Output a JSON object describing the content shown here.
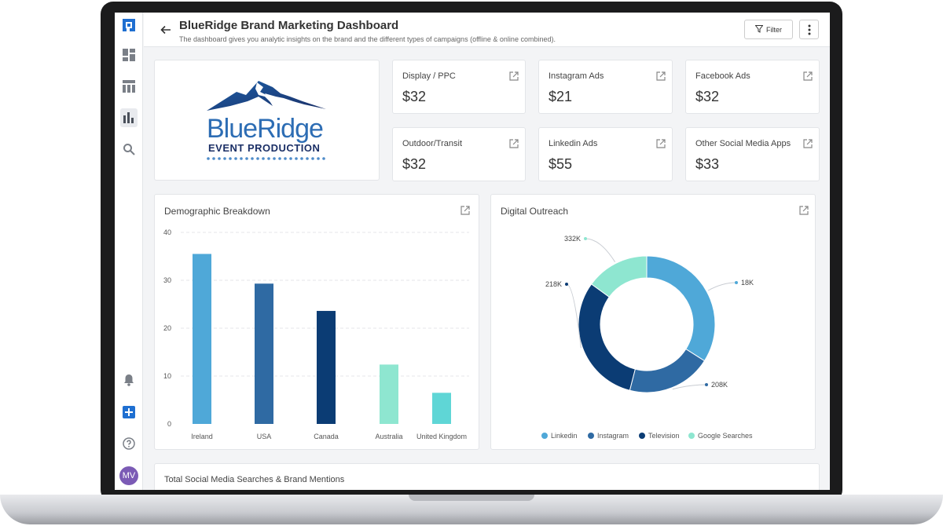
{
  "header": {
    "title": "BlueRidge Brand Marketing Dashboard",
    "subtitle": "The dashboard gives you analytic insights on the brand and the different types of campaigns (offline & online combined).",
    "filter_label": "Filter"
  },
  "logo": {
    "line1": "BlueRidge",
    "line2": "EVENT PRODUCTION"
  },
  "metrics": [
    {
      "label": "Display / PPC",
      "value": "$32"
    },
    {
      "label": "Instagram Ads",
      "value": "$21"
    },
    {
      "label": "Facebook Ads",
      "value": "$32"
    },
    {
      "label": "Outdoor/Transit",
      "value": "$32"
    },
    {
      "label": "Linkedin Ads",
      "value": "$55"
    },
    {
      "label": "Other Social Media Apps",
      "value": "$33"
    }
  ],
  "demographic": {
    "title": "Demographic Breakdown"
  },
  "outreach": {
    "title": "Digital Outreach"
  },
  "social": {
    "title": "Total Social Media Searches & Brand Mentions"
  },
  "user": {
    "initials": "MV"
  },
  "colors": {
    "accent": "#1f6fd1",
    "light_blue": "#4fa8d8",
    "mid_blue": "#2f6aa3",
    "navy": "#0b3c74",
    "mint": "#8ee6d0",
    "teal": "#5fd6d6"
  },
  "chart_data": [
    {
      "type": "bar",
      "title": "Demographic Breakdown",
      "categories": [
        "Ireland",
        "USA",
        "Canada",
        "Australia",
        "United Kingdom"
      ],
      "values": [
        35.5,
        29.3,
        23.6,
        12.4,
        6.5
      ],
      "colors": [
        "#4fa8d8",
        "#2f6aa3",
        "#0b3c74",
        "#8ee6d0",
        "#5fd6d6"
      ],
      "ylim": [
        0,
        40
      ],
      "yticks": [
        0,
        10,
        20,
        30,
        40
      ],
      "grid": true
    },
    {
      "type": "pie",
      "title": "Digital Outreach",
      "donut": true,
      "slices": [
        {
          "name": "Linkedin",
          "value": 34,
          "label": "18K",
          "color": "#4fa8d8"
        },
        {
          "name": "Instagram",
          "value": 20,
          "label": "208K",
          "color": "#2f6aa3"
        },
        {
          "name": "Television",
          "value": 31,
          "label": "218K",
          "color": "#0b3c74"
        },
        {
          "name": "Google Searches",
          "value": 15,
          "label": "332K",
          "color": "#8ee6d0"
        }
      ],
      "legend": "bottom"
    }
  ]
}
